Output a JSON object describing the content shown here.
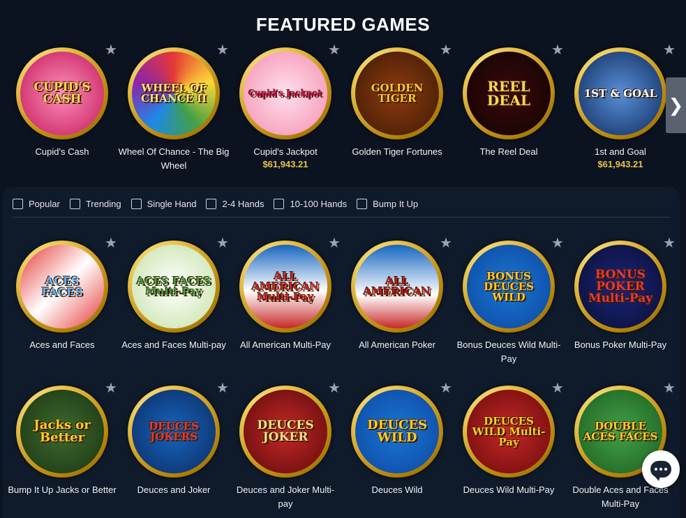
{
  "featured": {
    "title": "FEATURED GAMES",
    "games": [
      {
        "name": "Cupid's Cash",
        "art": "CUPID'S CASH",
        "jackpot": ""
      },
      {
        "name": "Wheel Of Chance - The Big Wheel",
        "art": "WHEEL OF CHANCE II",
        "jackpot": ""
      },
      {
        "name": "Cupid's Jackpot",
        "art": "Cupid's Jackpot",
        "jackpot": "$61,943.21"
      },
      {
        "name": "Golden Tiger Fortunes",
        "art": "GOLDEN TIGER",
        "jackpot": ""
      },
      {
        "name": "The Reel Deal",
        "art": "REEL DEAL",
        "jackpot": ""
      },
      {
        "name": "1st and Goal",
        "art": "1ST & GOAL",
        "jackpot": "$61,943.21"
      }
    ],
    "next_icon": "chevron-right-icon"
  },
  "filters": [
    {
      "label": "Popular",
      "checked": false
    },
    {
      "label": "Trending",
      "checked": false
    },
    {
      "label": "Single Hand",
      "checked": false
    },
    {
      "label": "2-4 Hands",
      "checked": false
    },
    {
      "label": "10-100 Hands",
      "checked": false
    },
    {
      "label": "Bump It Up",
      "checked": false
    }
  ],
  "games_row1": [
    {
      "name": "Aces and Faces",
      "art": "ACES FACES"
    },
    {
      "name": "Aces and Faces Multi-pay",
      "art": "ACES FACES Multi-Pay"
    },
    {
      "name": "All American Multi-Pay",
      "art": "ALL AMERICAN Multi-Pay"
    },
    {
      "name": "All American Poker",
      "art": "ALL AMERICAN"
    },
    {
      "name": "Bonus Deuces Wild Multi-Pay",
      "art": "BONUS DEUCES WILD"
    },
    {
      "name": "Bonus Poker Multi-Pay",
      "art": "BONUS POKER Multi-Pay"
    }
  ],
  "games_row2": [
    {
      "name": "Bump It Up Jacks or Better",
      "art": "Jacks or Better"
    },
    {
      "name": "Deuces and Joker",
      "art": "DEUCES JOKERS"
    },
    {
      "name": "Deuces and Joker Multi-pay",
      "art": "DEUCES JOKER"
    },
    {
      "name": "Deuces Wild",
      "art": "DEUCES WILD"
    },
    {
      "name": "Deuces Wild Multi-Pay",
      "art": "DEUCES WILD Multi-Pay"
    },
    {
      "name": "Double Aces and Faces Multi-Pay",
      "art": "DOUBLE ACES FACES"
    }
  ],
  "colors": {
    "background": "#0b1320",
    "panel": "#0f1a2a",
    "jackpot": "#e8c24a",
    "star": "#9ba3ad"
  },
  "icons": {
    "favorite": "star-icon",
    "chat": "chat-icon"
  }
}
